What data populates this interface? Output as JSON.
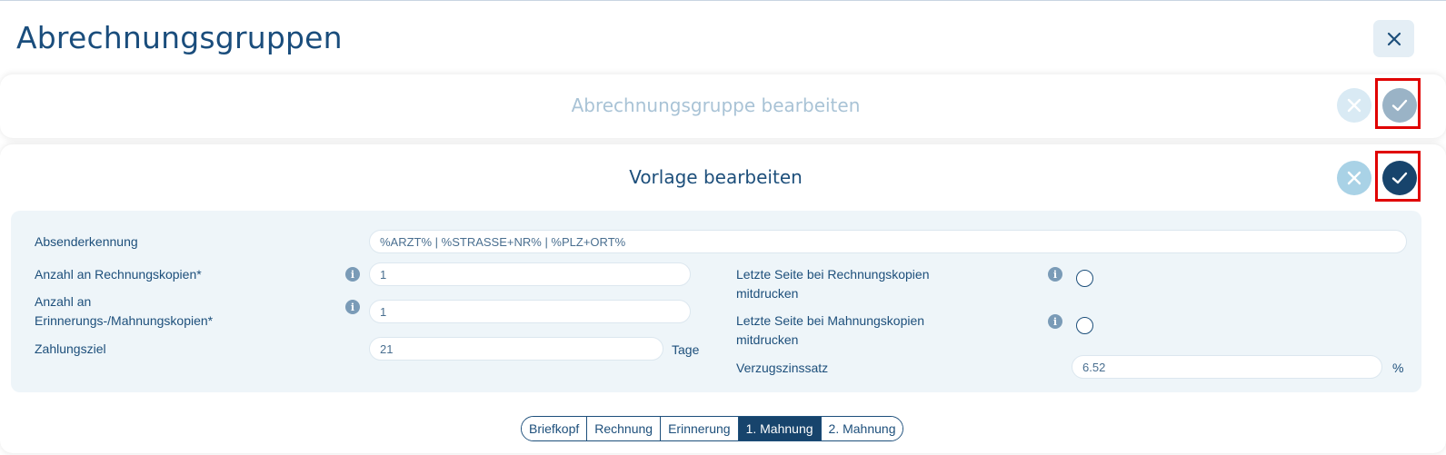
{
  "header": {
    "title": "Abrechnungsgruppen"
  },
  "panel_group": {
    "title": "Abrechnungsgruppe bearbeiten"
  },
  "panel_template": {
    "title": "Vorlage bearbeiten"
  },
  "form": {
    "sender_label": "Absenderkennung",
    "sender_value": "%ARZT% | %STRASSE+NR% | %PLZ+ORT%",
    "invoice_copies_label": "Anzahl an Rechnungskopien*",
    "invoice_copies_value": "1",
    "reminder_copies_label_line1": "Anzahl an",
    "reminder_copies_label_line2": "Erinnerungs-/Mahnungskopien*",
    "reminder_copies_value": "1",
    "payment_term_label": "Zahlungsziel",
    "payment_term_value": "21",
    "payment_term_unit": "Tage",
    "last_page_invoice_label_line1": "Letzte Seite bei Rechnungskopien",
    "last_page_invoice_label_line2": "mitdrucken",
    "last_page_reminder_label_line1": "Letzte Seite bei Mahnungskopien",
    "last_page_reminder_label_line2": "mitdrucken",
    "interest_label": "Verzugszinssatz",
    "interest_value": "6.52",
    "interest_unit": "%",
    "info_glyph": "i"
  },
  "tabs": [
    {
      "label": "Briefkopf",
      "active": false
    },
    {
      "label": "Rechnung",
      "active": false
    },
    {
      "label": "Erinnerung",
      "active": false
    },
    {
      "label": "1. Mahnung",
      "active": true
    },
    {
      "label": "2. Mahnung",
      "active": false
    }
  ],
  "icons": {
    "close": "close-icon",
    "cancel": "close-icon",
    "confirm": "check-icon",
    "info": "info-icon"
  },
  "colors": {
    "primary": "#17446c",
    "title_muted": "#a9c3d6",
    "highlight": "#e00000",
    "form_background": "#eef5f9"
  }
}
